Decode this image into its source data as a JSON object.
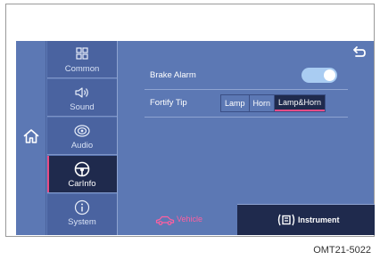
{
  "nav": {
    "items": [
      {
        "label": "Common",
        "icon": "grid-icon"
      },
      {
        "label": "Sound",
        "icon": "speaker-icon"
      },
      {
        "label": "Audio",
        "icon": "disc-icon"
      },
      {
        "label": "CarInfo",
        "icon": "steering-wheel-icon",
        "active": true
      },
      {
        "label": "System",
        "icon": "info-icon"
      }
    ]
  },
  "settings": {
    "brake_alarm_label": "Brake Alarm",
    "brake_alarm_on": true,
    "fortify_tip_label": "Fortify Tip",
    "fortify_options": [
      "Lamp",
      "Horn",
      "Lamp&Horn"
    ],
    "fortify_selected": "Lamp&Horn"
  },
  "tabs": {
    "vehicle_label": "Vehicle",
    "instrument_label": "Instrument",
    "active": "Instrument"
  },
  "caption": "OMT21-5022",
  "colors": {
    "background": "#5c78b4",
    "nav_item": "#4a63a0",
    "active": "#1f2a4d",
    "accent": "#e64b86",
    "toggle_on": "#a9ccf2"
  }
}
